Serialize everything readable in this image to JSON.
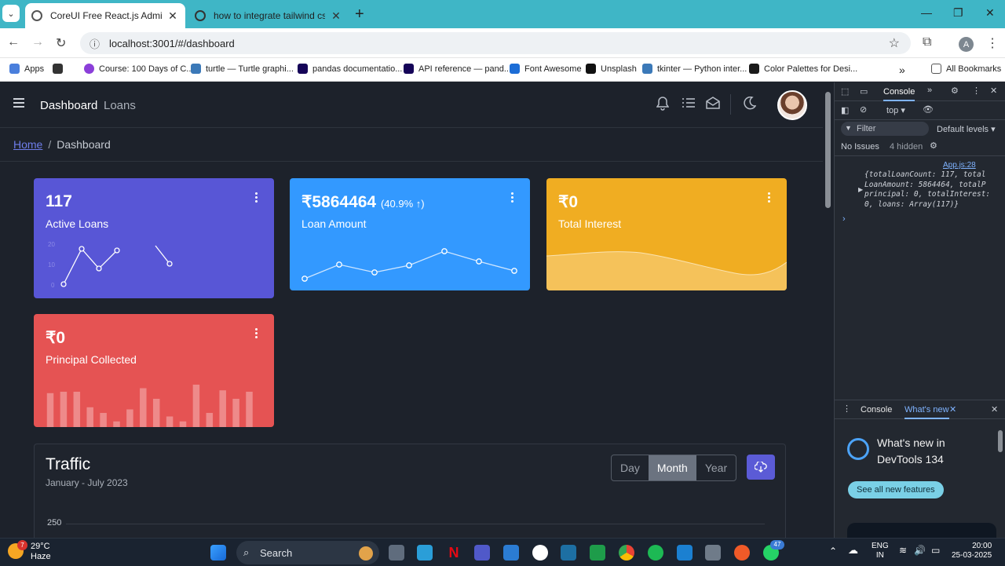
{
  "browser": {
    "tabs": [
      {
        "title": "CoreUI Free React.js Admin Templ",
        "active": true
      },
      {
        "title": "how to integrate tailwind css with",
        "active": false
      }
    ],
    "url": "localhost:3001/#/dashboard",
    "profile_initial": "A",
    "bookmarks": [
      {
        "label": "Apps",
        "color": "#4a7fdc"
      },
      {
        "label": "",
        "color": "#333333"
      },
      {
        "label": "Course: 100 Days of C...",
        "color": "#8b3fd9"
      },
      {
        "label": "turtle — Turtle graphi...",
        "color": "#3b79b8"
      },
      {
        "label": "pandas documentatio...",
        "color": "#150458"
      },
      {
        "label": "API reference — pand...",
        "color": "#150458"
      },
      {
        "label": "Font Awesome",
        "color": "#1c6dd6"
      },
      {
        "label": "Unsplash",
        "color": "#111111"
      },
      {
        "label": "tkinter — Python inter...",
        "color": "#3b79b8"
      },
      {
        "label": "Color Palettes for Desi...",
        "color": "#1a1a1a"
      }
    ],
    "all_bookmarks": "All Bookmarks"
  },
  "header": {
    "nav": [
      "Dashboard",
      "Loans"
    ]
  },
  "breadcrumb": {
    "home": "Home",
    "separator": "/",
    "current": "Dashboard"
  },
  "cards": [
    {
      "value": "117",
      "sub": "",
      "label": "Active Loans",
      "color": "#5856d6"
    },
    {
      "value": "₹5864464",
      "sub": "(40.9% ↑)",
      "label": "Loan Amount",
      "color": "#3399ff"
    },
    {
      "value": "₹0",
      "sub": "",
      "label": "Total Interest",
      "color": "#f9b115"
    },
    {
      "value": "₹0",
      "sub": "",
      "label": "Principal Collected",
      "color": "#e55353"
    }
  ],
  "card_charts": {
    "active_loans_line": [
      null,
      10,
      45,
      25,
      40,
      null,
      48,
      30
    ],
    "loan_amount_line": [
      10,
      30,
      22,
      28,
      45,
      32,
      20
    ],
    "principal_bars": [
      48,
      50,
      50,
      28,
      20,
      8,
      25,
      55,
      40,
      15,
      8,
      60,
      20,
      52,
      40,
      50
    ]
  },
  "traffic": {
    "title": "Traffic",
    "subtitle": "January - July 2023",
    "periods": [
      "Day",
      "Month",
      "Year"
    ],
    "active_period": "Month",
    "y_tick": "250"
  },
  "devtools": {
    "top_tab": "Console",
    "context": "top ▾",
    "filter_placeholder": "Filter",
    "levels": "Default levels ▾",
    "issues": "No Issues",
    "hidden": "4 hidden",
    "source_link": "App.js:28",
    "log_lines": [
      "{totalLoanCount: 117, total",
      "LoanAmount: 5864464, totalP",
      "principal: 0, totalInterest:",
      "0, loans: Array(117)}"
    ],
    "bottom_tabs": [
      "Console",
      "What's new"
    ],
    "whats_new_title": "What's new in DevTools 134",
    "see_all": "See all new features"
  },
  "taskbar": {
    "temperature": "29°C",
    "weather": "Haze",
    "search": "Search",
    "lang": "ENG",
    "region": "IN",
    "time": "20:00",
    "date": "25-03-2025",
    "whatsapp_badge": "47",
    "weather_badge": "7"
  }
}
